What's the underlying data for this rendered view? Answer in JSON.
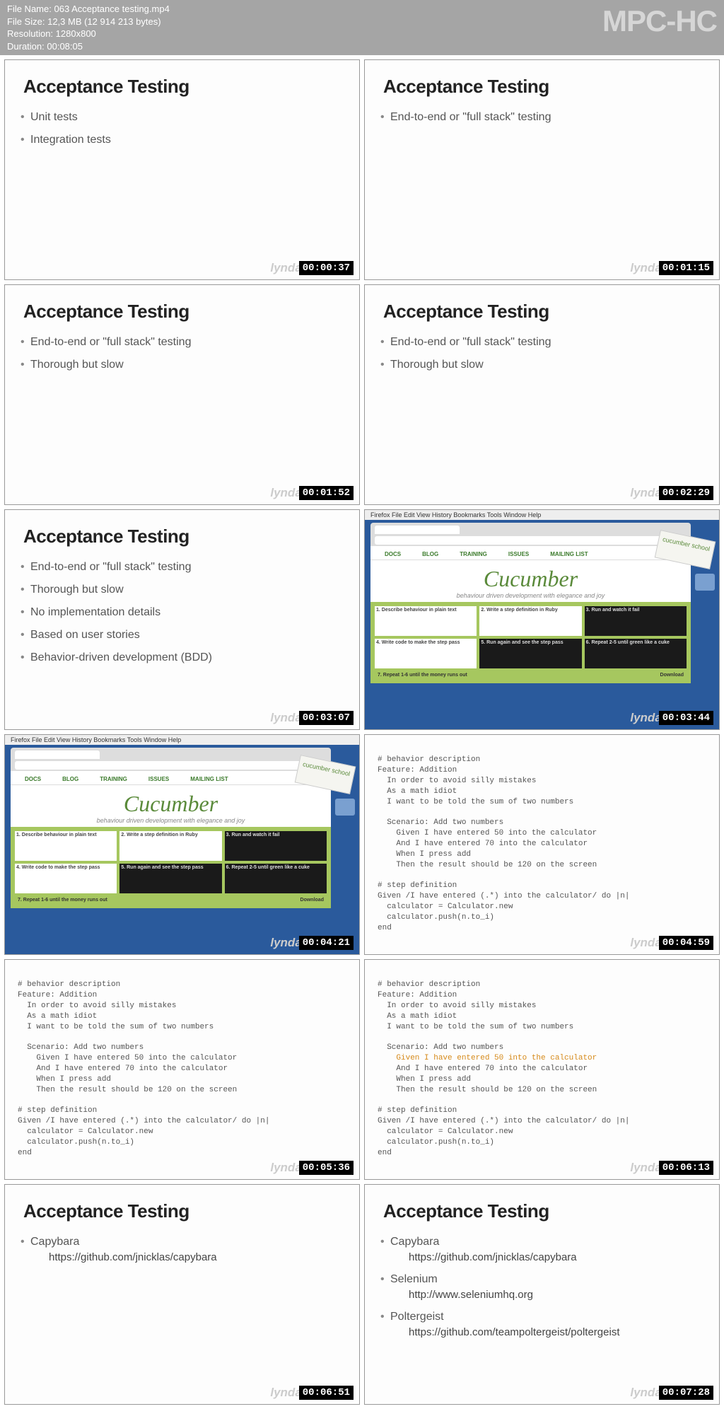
{
  "app_watermark": "MPC-HC",
  "meta": {
    "file_name_label": "File Name:",
    "file_name": "063 Acceptance testing.mp4",
    "file_size_label": "File Size:",
    "file_size": "12,3 MB (12 914 213 bytes)",
    "resolution_label": "Resolution:",
    "resolution": "1280x800",
    "duration_label": "Duration:",
    "duration": "00:08:05"
  },
  "lynda_mark": "lynda",
  "thumbs": [
    {
      "type": "slide",
      "title": "Acceptance Testing",
      "ts": "00:00:37",
      "bullets": [
        "Unit tests",
        "Integration tests"
      ]
    },
    {
      "type": "slide",
      "title": "Acceptance Testing",
      "ts": "00:01:15",
      "bullets": [
        "End-to-end or \"full stack\" testing"
      ]
    },
    {
      "type": "slide",
      "title": "Acceptance Testing",
      "ts": "00:01:52",
      "bullets": [
        "End-to-end or \"full stack\" testing",
        "Thorough but slow"
      ]
    },
    {
      "type": "slide",
      "title": "Acceptance Testing",
      "ts": "00:02:29",
      "bullets": [
        "End-to-end or \"full stack\" testing",
        "Thorough but slow"
      ]
    },
    {
      "type": "slide",
      "title": "Acceptance Testing",
      "ts": "00:03:07",
      "bullets": [
        "End-to-end or \"full stack\" testing",
        "Thorough but slow",
        "No implementation details",
        "Based on user stories",
        "Behavior-driven development (BDD)"
      ]
    },
    {
      "type": "cucumber",
      "ts": "00:03:44"
    },
    {
      "type": "cucumber",
      "ts": "00:04:21"
    },
    {
      "type": "code",
      "ts": "00:04:59",
      "highlight": null
    },
    {
      "type": "code",
      "ts": "00:05:36",
      "highlight": null
    },
    {
      "type": "code",
      "ts": "00:06:13",
      "highlight": 6
    },
    {
      "type": "slide",
      "title": "Acceptance Testing",
      "ts": "00:06:51",
      "bullets_rich": [
        {
          "label": "Capybara",
          "sub": "https://github.com/jnicklas/capybara"
        }
      ]
    },
    {
      "type": "slide",
      "title": "Acceptance Testing",
      "ts": "00:07:28",
      "bullets_rich": [
        {
          "label": "Capybara",
          "sub": "https://github.com/jnicklas/capybara"
        },
        {
          "label": "Selenium",
          "sub": "http://www.seleniumhq.org"
        },
        {
          "label": "Poltergeist",
          "sub": "https://github.com/teampoltergeist/poltergeist"
        }
      ]
    }
  ],
  "cucumber": {
    "mac_menu": "Firefox  File  Edit  View  History  Bookmarks  Tools  Window  Help",
    "nav": [
      "DOCS",
      "BLOG",
      "TRAINING",
      "ISSUES",
      "MAILING LIST"
    ],
    "name": "Cucumber",
    "tagline": "behaviour driven development with elegance and joy",
    "school": "cucumber school",
    "steps": [
      {
        "title": "1. Describe behaviour in plain text",
        "dark": false
      },
      {
        "title": "2. Write a step definition in Ruby",
        "dark": false
      },
      {
        "title": "3. Run and watch it fail",
        "dark": true
      },
      {
        "title": "4. Write code to make the step pass",
        "dark": false
      },
      {
        "title": "5. Run again and see the step pass",
        "dark": true
      },
      {
        "title": "6. Repeat 2-5 until green like a cuke",
        "dark": true
      }
    ],
    "footer_left": "7. Repeat 1-6 until the money runs out",
    "footer_right": "Download"
  },
  "code_lines": [
    "# behavior description",
    "Feature: Addition",
    "  In order to avoid silly mistakes",
    "  As a math idiot",
    "  I want to be told the sum of two numbers",
    "",
    "  Scenario: Add two numbers",
    "    Given I have entered 50 into the calculator",
    "    And I have entered 70 into the calculator",
    "    When I press add",
    "    Then the result should be 120 on the screen",
    "",
    "# step definition",
    "Given /I have entered (.*) into the calculator/ do |n|",
    "  calculator = Calculator.new",
    "  calculator.push(n.to_i)",
    "end"
  ]
}
